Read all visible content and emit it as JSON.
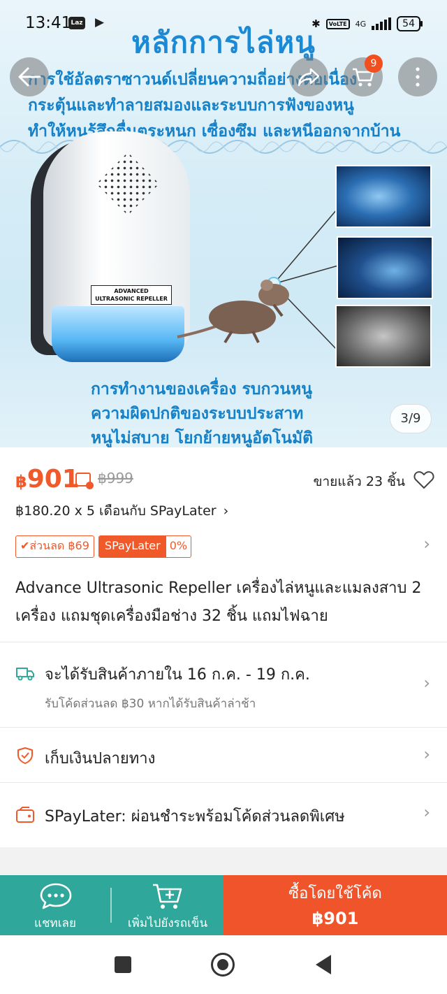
{
  "status_bar": {
    "time": "13:41",
    "laz_label": "Laz",
    "network": "4G",
    "volte": "VoLTE",
    "battery": "54"
  },
  "hero": {
    "title": "หลักการไล่หนู",
    "lines": [
      "การใช้อัลตราซาวนด์เปลี่ยนความถี่อย่างต่อเนื่อง",
      "กระตุ้นและทำลายสมองและระบบการฟังของหนู",
      "ทำให้หนูรู้สึกตื่นตระหนก เซื่องซึม และหนีออกจากบ้าน"
    ],
    "device_label": [
      "ADVANCED",
      "ULTRASONIC REPELLER"
    ],
    "bottom_lines": [
      "การทำงานของเครื่อง    รบกวนหนู",
      "ความผิดปกติของระบบประสาท",
      "หนูไม่สบาย    โยกย้ายหนูอัตโนมัติ"
    ],
    "image_counter": "3/9",
    "cart_count": "9"
  },
  "price": {
    "currency": "฿",
    "current": "901",
    "original": "฿999",
    "sold": "ขายแล้ว 23 ชิ้น",
    "installment_prefix": "฿180.20 x 5 เดือนกับ ",
    "installment_brand": "SPayLater",
    "installment_chevron": "›"
  },
  "tags": {
    "discount": "✔ส่วนลด ฿69",
    "spaylater": "SPayLater",
    "spaylater_rate": "0%"
  },
  "product_title": "Advance Ultrasonic Repeller เครื่องไล่หนูและแมลงสาบ 2 เครื่อง แถมชุดเครื่องมือช่าง 32 ชิ้น แถมไฟฉาย",
  "delivery": {
    "text": "จะได้รับสินค้าภายใน 16 ก.ค. - 19 ก.ค.",
    "subtext": "รับโค้ดส่วนลด ฿30 หากได้รับสินค้าล่าช้า"
  },
  "cod": {
    "text": "เก็บเงินปลายทาง"
  },
  "spaylater_row": {
    "text": "SPayLater: ผ่อนชำระพร้อมโค้ดส่วนลดพิเศษ"
  },
  "bottom_bar": {
    "chat_label": "แชทเลย",
    "add_cart_label": "เพิ่มไปยังรถเข็น",
    "buy_label": "ซื้อโดยใช้โค้ด",
    "buy_price": "฿901"
  },
  "colors": {
    "accent": "#f0592a",
    "green": "#2fa79a",
    "buy": "#f0542b"
  }
}
